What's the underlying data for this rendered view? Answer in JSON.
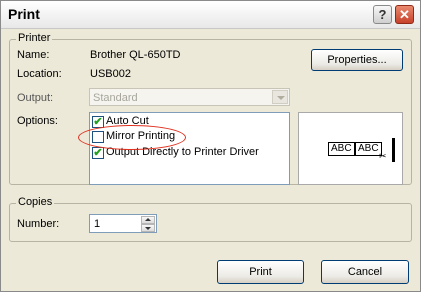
{
  "window": {
    "title": "Print",
    "help_glyph": "?",
    "close_glyph": "✕"
  },
  "printer_group": {
    "label": "Printer",
    "name_label": "Name:",
    "name_value": "Brother QL-650TD",
    "location_label": "Location:",
    "location_value": "USB002",
    "properties_label": "Properties...",
    "output_label": "Output:",
    "output_value": "Standard",
    "options_label": "Options:",
    "options": [
      {
        "label": "Auto Cut",
        "checked": true,
        "check_glyph": "✔"
      },
      {
        "label": "Mirror Printing",
        "checked": false,
        "check_glyph": ""
      },
      {
        "label": "Output Directly to Printer Driver",
        "checked": true,
        "check_glyph": "✔"
      }
    ],
    "preview": {
      "tape_text_1": "ABC",
      "tape_text_2": "ABC",
      "cut_mark": "✂"
    }
  },
  "copies_group": {
    "label": "Copies",
    "number_label": "Number:",
    "number_value": "1"
  },
  "actions": {
    "print_label": "Print",
    "cancel_label": "Cancel"
  },
  "colors": {
    "annotation_circle": "#e0301e",
    "check_mark": "#21a121"
  }
}
